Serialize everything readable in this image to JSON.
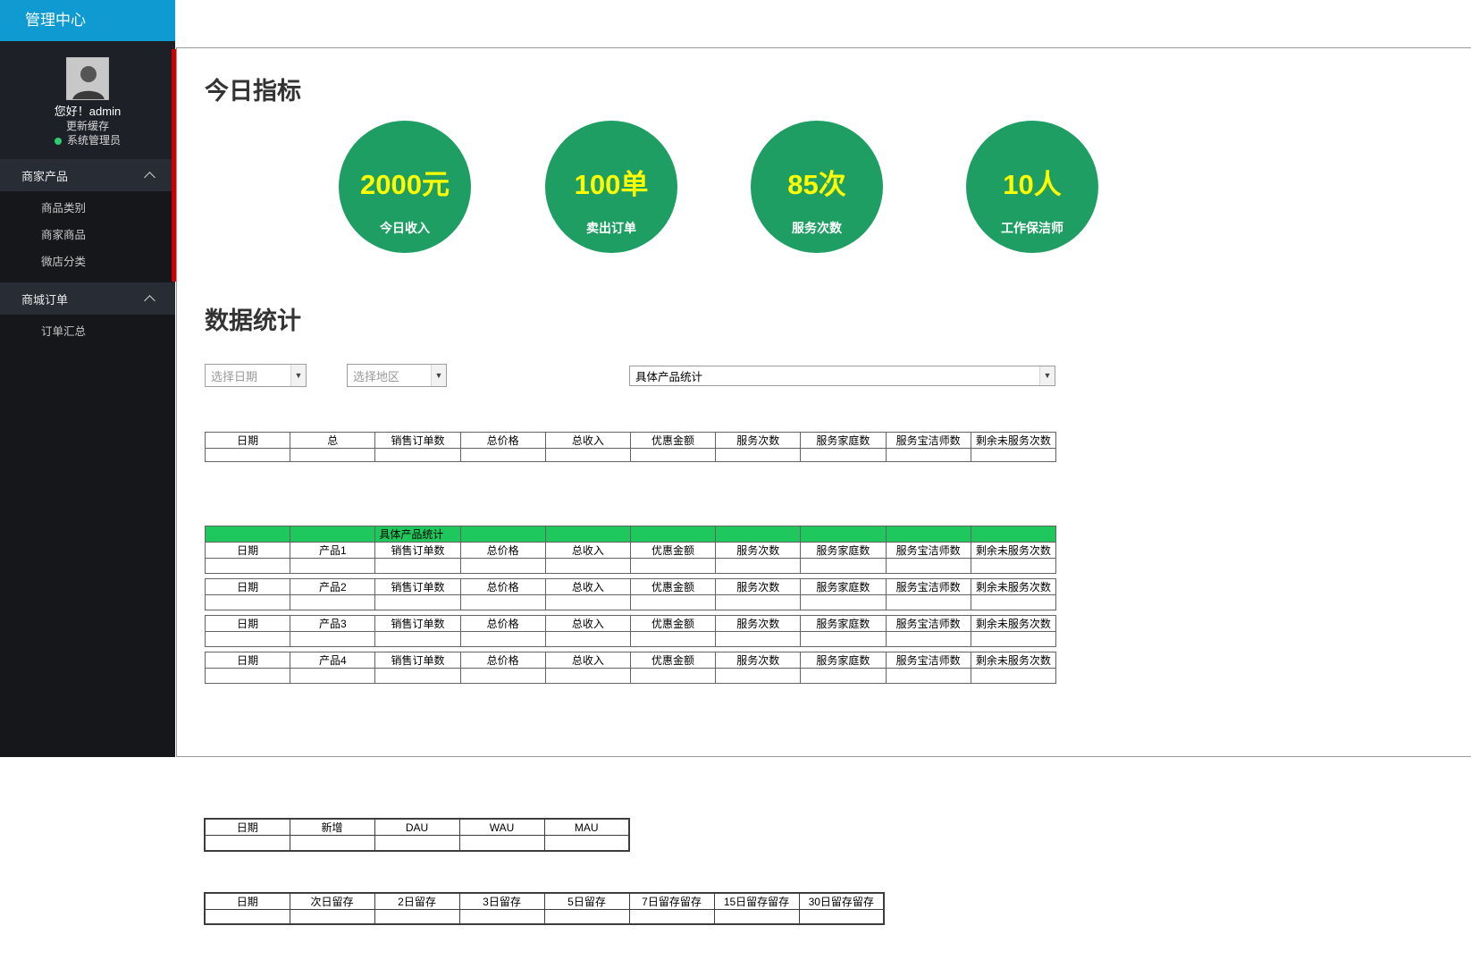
{
  "app_title": "管理中心",
  "sidebar": {
    "greeting": "您好！admin",
    "refresh_cache": "更新缓存",
    "role": "系统管理员",
    "menu": [
      {
        "label": "商家产品",
        "items": [
          "商品类别",
          "商家商品",
          "微店分类"
        ]
      },
      {
        "label": "商城订单",
        "items": [
          "订单汇总"
        ]
      }
    ]
  },
  "sections": {
    "today": "今日指标",
    "stats": "数据统计"
  },
  "metrics": [
    {
      "value": "2000元",
      "label": "今日收入"
    },
    {
      "value": "100单",
      "label": "卖出订单"
    },
    {
      "value": "85次",
      "label": "服务次数"
    },
    {
      "value": "10人",
      "label": "工作保洁师"
    }
  ],
  "filters": {
    "date_placeholder": "选择日期",
    "region_placeholder": "选择地区",
    "product_select_value": "具体产品统计"
  },
  "tables": {
    "summary": {
      "headers": [
        "日期",
        "总",
        "销售订单数",
        "总价格",
        "总收入",
        "优惠金额",
        "服务次数",
        "服务家庭数",
        "服务宝洁师数",
        "剩余未服务次数"
      ]
    },
    "products": {
      "banner": "具体产品统计",
      "rows": [
        [
          "日期",
          "产品1",
          "销售订单数",
          "总价格",
          "总收入",
          "优惠金额",
          "服务次数",
          "服务家庭数",
          "服务宝洁师数",
          "剩余未服务次数"
        ],
        [
          "日期",
          "产品2",
          "销售订单数",
          "总价格",
          "总收入",
          "优惠金额",
          "服务次数",
          "服务家庭数",
          "服务宝洁师数",
          "剩余未服务次数"
        ],
        [
          "日期",
          "产品3",
          "销售订单数",
          "总价格",
          "总收入",
          "优惠金额",
          "服务次数",
          "服务家庭数",
          "服务宝洁师数",
          "剩余未服务次数"
        ],
        [
          "日期",
          "产品4",
          "销售订单数",
          "总价格",
          "总收入",
          "优惠金额",
          "服务次数",
          "服务家庭数",
          "服务宝洁师数",
          "剩余未服务次数"
        ]
      ]
    },
    "users": {
      "headers": [
        "日期",
        "新增",
        "DAU",
        "WAU",
        "MAU"
      ]
    },
    "retention": {
      "headers": [
        "日期",
        "次日留存",
        "2日留存",
        "3日留存",
        "5日留存",
        "7日留存留存",
        "15日留存留存",
        "30日留存留存"
      ]
    }
  },
  "colors": {
    "accent_blue": "#0f9ad2",
    "circle_green": "#1e9e63",
    "value_yellow": "#ffff00",
    "banner_green": "#1ec85c",
    "online_dot": "#2ecc71",
    "scrollbar_red": "#d10000"
  }
}
